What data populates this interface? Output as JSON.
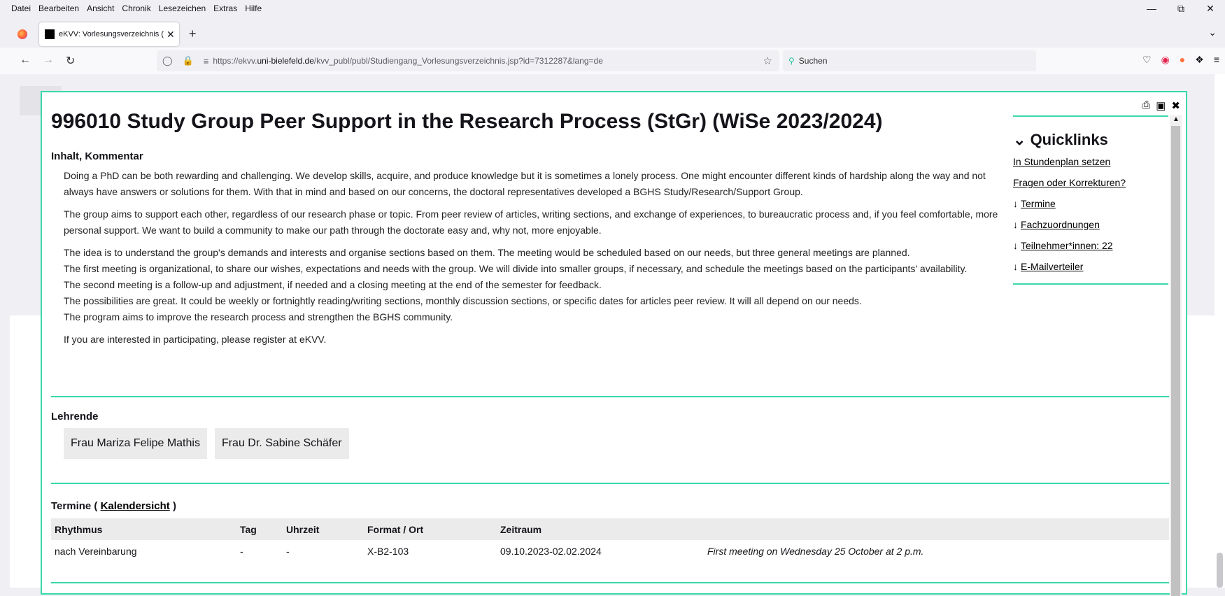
{
  "menubar": {
    "items": [
      "Datei",
      "Bearbeiten",
      "Ansicht",
      "Chronik",
      "Lesezeichen",
      "Extras",
      "Hilfe"
    ]
  },
  "tab": {
    "title": "eKVV: Vorlesungsverzeichnis (Ui"
  },
  "url": {
    "prefix": "https://ekvv.",
    "domain": "uni-bielefeld.de",
    "path": "/kvv_publ/publ/Studiengang_Vorlesungsverzeichnis.jsp?id=7312287&lang=de"
  },
  "search": {
    "placeholder": "Suchen"
  },
  "page": {
    "title": "996010 Study Group Peer Support in the Research Process (StGr) (WiSe 2023/2024)",
    "inhalt_heading": "Inhalt, Kommentar",
    "p1": "Doing a PhD can be both rewarding and challenging. We develop skills, acquire, and produce knowledge but it is sometimes a lonely process. One might encounter different kinds of hardship along the way and not always have answers or solutions for them. With that in mind and based on our concerns, the doctoral representatives developed a BGHS Study/Research/Support Group.",
    "p2": "The group aims to support each other, regardless of our research phase or topic. From peer review of articles, writing sections, and exchange of experiences, to bureaucratic process and, if you feel comfortable, more personal support. We want to build a community to make our path through the doctorate easy and, why not, more enjoyable.",
    "p3a": "The idea is to understand the group's demands and interests and organise sections based on them. The meeting would be scheduled based on our needs, but three general meetings are planned.",
    "p3b": "The first meeting is organizational, to share our wishes, expectations and needs with the group. We will divide into smaller groups, if necessary, and schedule the meetings based on the participants' availability.",
    "p3c": "The second meeting is a follow-up and adjustment, if needed and a closing meeting at the end of the semester for feedback.",
    "p3d": "The possibilities are great. It could be weekly or fortnightly reading/writing sections, monthly discussion sections, or specific dates for articles peer review. It will all depend on our needs.",
    "p3e": "The program aims to improve the research process and strengthen the BGHS community.",
    "p4": "If you are interested in participating, please register at eKVV.",
    "lehrende_heading": "Lehrende",
    "lehrende": [
      "Frau Mariza Felipe Mathis",
      "Frau Dr. Sabine Schäfer"
    ],
    "termine_prefix": "Termine ( ",
    "termine_link": "Kalendersicht",
    "termine_suffix": " )",
    "table_headers": [
      "Rhythmus",
      "Tag",
      "Uhrzeit",
      "Format / Ort",
      "Zeitraum",
      ""
    ],
    "table_row": [
      "nach Vereinbarung",
      "-",
      "-",
      "X-B2-103",
      "09.10.2023-02.02.2024",
      "First meeting on Wednesday 25 October at 2 p.m."
    ]
  },
  "quicklinks": {
    "heading": "Quicklinks",
    "links": [
      "In Stundenplan setzen",
      "Fragen oder Korrekturen?"
    ],
    "anchors": [
      "Termine",
      "Fachzuordnungen",
      "Teilnehmer*innen: 22",
      "E-Mailverteiler"
    ]
  },
  "colors": {
    "accent": "#3ad8aa"
  }
}
